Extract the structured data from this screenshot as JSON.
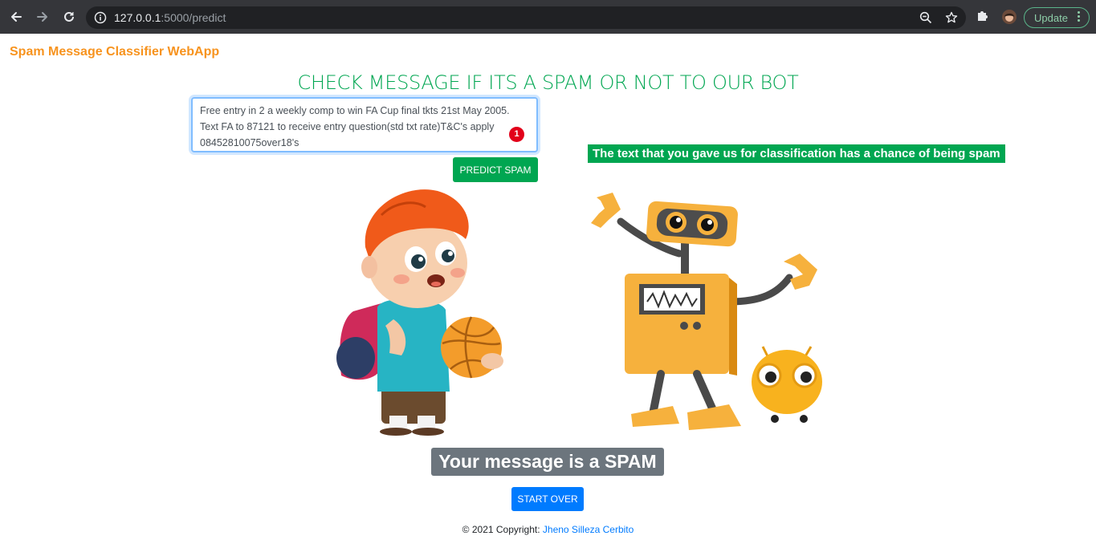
{
  "browser": {
    "url_host": "127.0.0.1",
    "url_rest": ":5000/predict",
    "update_label": "Update"
  },
  "page": {
    "brand": "Spam Message Classifier WebApp",
    "heading": "CHECK MESSAGE IF ITS A SPAM OR NOT TO OUR BOT",
    "message_value": "Free entry in 2 a weekly comp to win FA Cup final tkts 21st May 2005. Text FA to 87121 to receive entry question(std txt rate)T&C's apply 08452810075over18's",
    "grammar_count": "1",
    "predict_label": "PREDICT SPAM",
    "result_banner": "The text that you gave us for classification has a chance of being spam",
    "verdict": "Your message is a SPAM",
    "start_over_label": "START OVER",
    "footer_prefix": "© 2021 Copyright: ",
    "footer_author": "Jheno Silleza Cerbito"
  },
  "colors": {
    "brand": "#f7931e",
    "accent_green": "#00a651",
    "primary_blue": "#007bff",
    "verdict_gray": "#6c757d"
  },
  "icons": [
    "back-arrow-icon",
    "forward-arrow-icon",
    "reload-icon",
    "info-icon",
    "zoom-icon",
    "star-icon",
    "puzzle-icon",
    "kebab-menu-icon"
  ]
}
